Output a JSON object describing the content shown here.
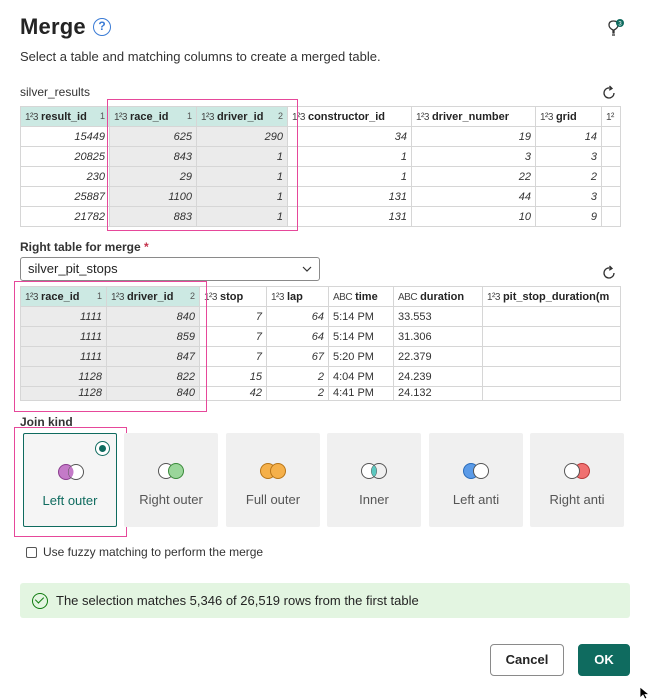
{
  "header": {
    "title": "Merge",
    "subtitle": "Select a table and matching columns to create a merged table."
  },
  "left_table": {
    "name": "silver_results",
    "type_glyph": "1²3",
    "columns": [
      {
        "name": "result_id",
        "order": "1",
        "selected": false
      },
      {
        "name": "race_id",
        "order": "1",
        "selected": true
      },
      {
        "name": "driver_id",
        "order": "2",
        "selected": true
      },
      {
        "name": "constructor_id",
        "order": "",
        "selected": false
      },
      {
        "name": "driver_number",
        "order": "",
        "selected": false
      },
      {
        "name": "grid",
        "order": "",
        "selected": false
      }
    ],
    "rows": [
      [
        "15449",
        "625",
        "290",
        "34",
        "19",
        "14"
      ],
      [
        "20825",
        "843",
        "1",
        "1",
        "3",
        "3"
      ],
      [
        "230",
        "29",
        "1",
        "1",
        "22",
        "2"
      ],
      [
        "25887",
        "1100",
        "1",
        "131",
        "44",
        "3"
      ],
      [
        "21782",
        "883",
        "1",
        "131",
        "10",
        "9"
      ]
    ]
  },
  "right_table": {
    "label": "Right table for merge",
    "required_mark": "*",
    "selected_value": "silver_pit_stops",
    "columns": [
      {
        "name": "race_id",
        "order": "1",
        "type": "1²3"
      },
      {
        "name": "driver_id",
        "order": "2",
        "type": "1²3"
      },
      {
        "name": "stop",
        "order": "",
        "type": "1²3"
      },
      {
        "name": "lap",
        "order": "",
        "type": "1²3"
      },
      {
        "name": "time",
        "order": "",
        "type": "ABC"
      },
      {
        "name": "duration",
        "order": "",
        "type": "ABC"
      },
      {
        "name": "pit_stop_duration(m",
        "order": "",
        "type": "1²3"
      }
    ],
    "rows": [
      [
        "1111",
        "840",
        "7",
        "64",
        "5:14 PM",
        "33.553",
        ""
      ],
      [
        "1111",
        "859",
        "7",
        "64",
        "5:14 PM",
        "31.306",
        ""
      ],
      [
        "1111",
        "847",
        "7",
        "67",
        "5:20 PM",
        "22.379",
        ""
      ],
      [
        "1128",
        "822",
        "15",
        "2",
        "4:04 PM",
        "24.239",
        ""
      ],
      [
        "1128",
        "840",
        "42",
        "2",
        "4:41 PM",
        "24.132",
        ""
      ]
    ]
  },
  "join": {
    "label": "Join kind",
    "options": [
      {
        "id": "left-outer",
        "label": "Left outer",
        "selected": true
      },
      {
        "id": "right-outer",
        "label": "Right outer",
        "selected": false
      },
      {
        "id": "full-outer",
        "label": "Full outer",
        "selected": false
      },
      {
        "id": "inner",
        "label": "Inner",
        "selected": false
      },
      {
        "id": "left-anti",
        "label": "Left anti",
        "selected": false
      },
      {
        "id": "right-anti",
        "label": "Right anti",
        "selected": false
      }
    ]
  },
  "fuzzy": {
    "label": "Use fuzzy matching to perform the merge",
    "checked": false
  },
  "status": {
    "message": "The selection matches 5,346 of 26,519 rows from the first table"
  },
  "buttons": {
    "cancel": "Cancel",
    "ok": "OK"
  },
  "badges": {
    "bulb_count": "3"
  },
  "colors": {
    "accent": "#0f6b5f",
    "highlight": "#e6489a",
    "selected_header": "#cce9e3",
    "success_bg": "#e3f5e1"
  }
}
